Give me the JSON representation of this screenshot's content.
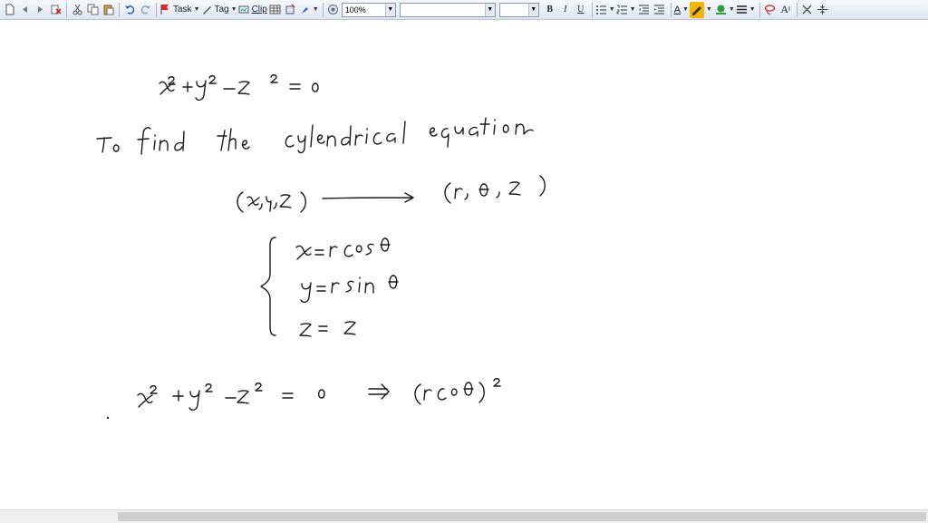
{
  "toolbar": {
    "task_label": "Task",
    "tag_label": "Tag",
    "clip_label": "Clip",
    "zoom_value": "100%",
    "font_name_value": "",
    "font_size_value": "",
    "bold_label": "B",
    "italic_label": "I",
    "underline_label": "U",
    "font_color_label": "A",
    "text_size_label": "A"
  },
  "icons": {
    "new": "new-page-icon",
    "back": "back-icon",
    "forward": "forward-icon",
    "delete": "delete-icon",
    "cut": "cut-icon",
    "copy": "copy-icon",
    "paste": "paste-icon",
    "undo": "undo-icon",
    "redo": "redo-icon",
    "task": "flag-icon",
    "tag": "pen-tag-icon",
    "clip": "clip-icon",
    "table": "table-icon",
    "attach": "attach-icon",
    "pen": "pen-icon",
    "zoom": "zoom-icon",
    "bullets": "bullet-list-icon",
    "numbering": "numbered-list-icon",
    "outdent": "outdent-icon",
    "indent": "indent-icon",
    "highlight": "highlighter-icon",
    "fill": "fill-color-icon",
    "line": "line-style-icon",
    "lasso": "lasso-icon",
    "eraser": "eraser-icon",
    "split": "split-icon"
  },
  "colors": {
    "highlight": "#f4b400",
    "fill": "#2e9e3e",
    "ink": "#1a1a1a"
  }
}
